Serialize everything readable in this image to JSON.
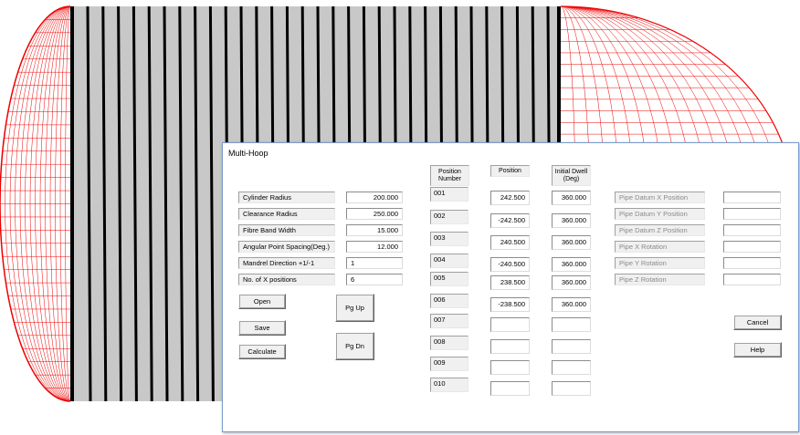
{
  "dialog": {
    "title": "Multi-Hoop",
    "params": [
      {
        "label": "Cylinder Radius",
        "value": "200.000"
      },
      {
        "label": "Clearance Radius",
        "value": "250.000"
      },
      {
        "label": "Fibre Band Width",
        "value": "15.000"
      },
      {
        "label": "Angular Point Spacing(Deg.)",
        "value": "12.000"
      },
      {
        "label": "Mandrel Direction +1/-1",
        "value": "1"
      },
      {
        "label": "No. of X positions",
        "value": "6"
      }
    ],
    "buttons": {
      "open": "Open",
      "save": "Save",
      "calculate": "Calculate",
      "pg_up": "Pg Up",
      "pg_dn": "Pg Dn",
      "cancel": "Cancel",
      "help": "Help"
    },
    "headers": {
      "position_number": "Position Number",
      "position": "Position",
      "initial_dwell": "Initial Dwell (Deg)"
    },
    "rows": [
      {
        "number": "001",
        "position": "242.500",
        "dwell": "360.000"
      },
      {
        "number": "002",
        "position": "-242.500",
        "dwell": "360.000"
      },
      {
        "number": "003",
        "position": "240.500",
        "dwell": "360.000"
      },
      {
        "number": "004",
        "position": "-240.500",
        "dwell": "360.000"
      },
      {
        "number": "005",
        "position": "238.500",
        "dwell": "360.000"
      },
      {
        "number": "006",
        "position": "-238.500",
        "dwell": "360.000"
      },
      {
        "number": "007",
        "position": "",
        "dwell": ""
      },
      {
        "number": "008",
        "position": "",
        "dwell": ""
      },
      {
        "number": "009",
        "position": "",
        "dwell": ""
      },
      {
        "number": "010",
        "position": "",
        "dwell": ""
      }
    ],
    "pipe": [
      {
        "label": "Pipe Datum X Position",
        "value": ""
      },
      {
        "label": "Pipe Datum Y Position",
        "value": ""
      },
      {
        "label": "Pipe Datum Z Position",
        "value": ""
      },
      {
        "label": "Pipe X Rotation",
        "value": ""
      },
      {
        "label": "Pipe Y Rotation",
        "value": ""
      },
      {
        "label": "Pipe Z Rotation",
        "value": ""
      }
    ]
  },
  "colors": {
    "mesh_red": "#ee0000",
    "cylinder_gray": "#c8c8c8",
    "hoop_black": "#000000"
  }
}
